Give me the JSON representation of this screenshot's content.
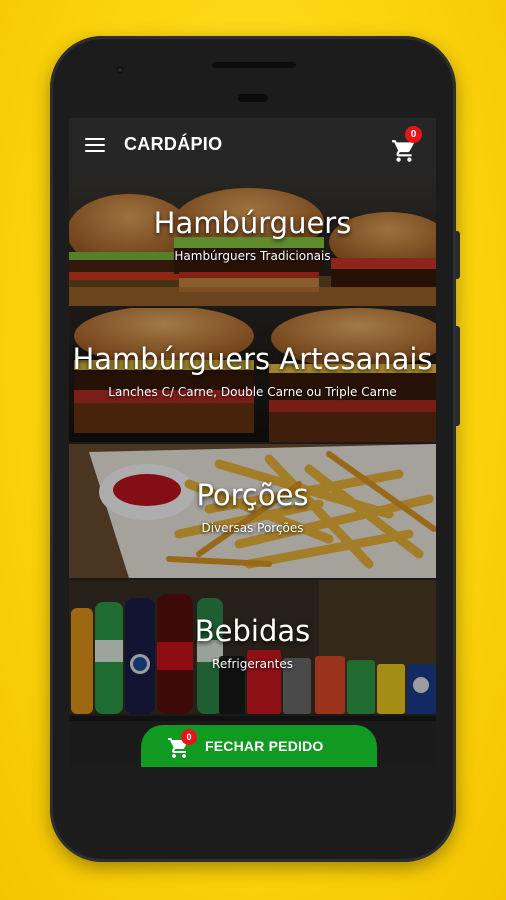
{
  "app": {
    "title": "CARDÁPIO",
    "cart_count": "0"
  },
  "categories": [
    {
      "name": "Hambúrguers",
      "subtitle": "Hambúrguers Tradicionais"
    },
    {
      "name": "Hambúrguers Artesanais",
      "subtitle": "Lanches C/ Carne, Double Carne ou Triple Carne"
    },
    {
      "name": "Porções",
      "subtitle": "Diversas Porções"
    },
    {
      "name": "Bebidas",
      "subtitle": "Refrigerantes"
    }
  ],
  "checkout": {
    "label": "FECHAR PEDIDO",
    "count": "0"
  },
  "colors": {
    "background": "#fcd50e",
    "appbar": "#262626",
    "badge": "#e8141c",
    "checkout": "#119a22"
  },
  "icons": [
    "menu-icon",
    "cart-icon"
  ]
}
